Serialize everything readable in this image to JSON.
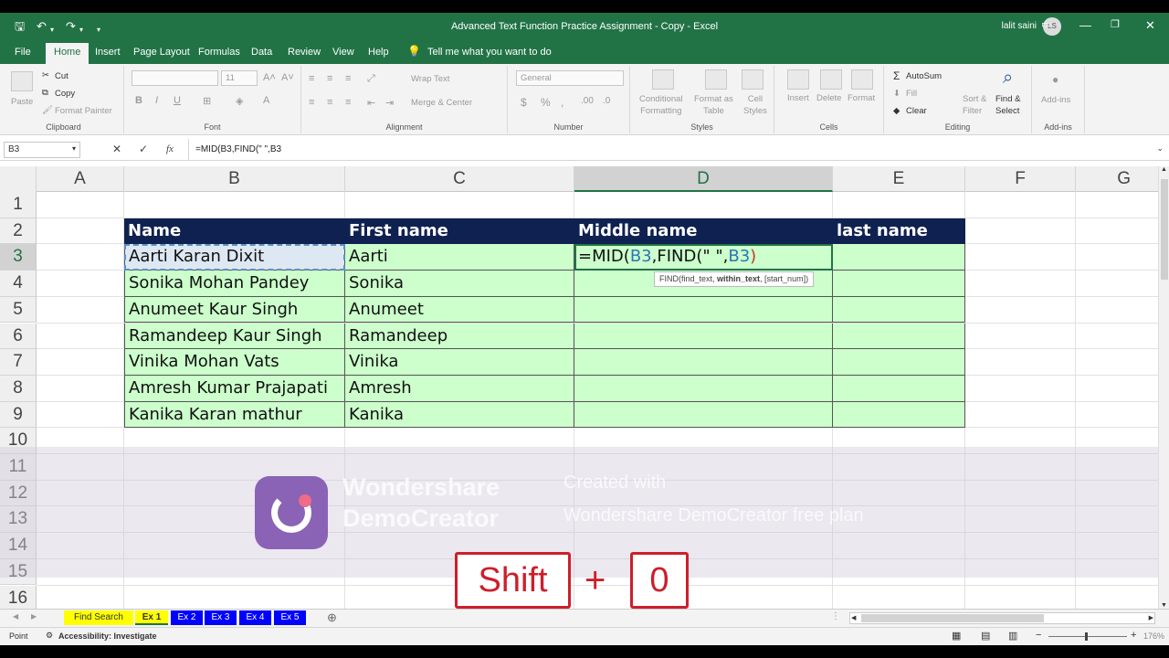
{
  "window": {
    "title": "Advanced Text Function Practice Assignment - Copy  -  Excel",
    "user": "lalit saini",
    "user_initials": "LS"
  },
  "qat": {
    "save": "🖫",
    "undo": "↶",
    "redo": "↷"
  },
  "tabs": [
    "File",
    "Home",
    "Insert",
    "Page Layout",
    "Formulas",
    "Data",
    "Review",
    "View",
    "Help"
  ],
  "tell_me": "Tell me what you want to do",
  "ribbon": {
    "clipboard": {
      "paste": "Paste",
      "cut": "Cut",
      "copy": "Copy",
      "format_painter": "Format Painter",
      "label": "Clipboard"
    },
    "font": {
      "size": "11",
      "label": "Font"
    },
    "alignment": {
      "wrap": "Wrap Text",
      "merge": "Merge & Center",
      "label": "Alignment"
    },
    "number": {
      "format": "General",
      "label": "Number"
    },
    "styles": {
      "cond": "Conditional\nFormatting",
      "fmt_table": "Format as\nTable",
      "cell_styles": "Cell\nStyles",
      "label": "Styles"
    },
    "cells": {
      "insert": "Insert",
      "delete": "Delete",
      "format": "Format",
      "label": "Cells"
    },
    "editing": {
      "autosum": "AutoSum",
      "fill": "Fill",
      "clear": "Clear",
      "sort": "Sort &\nFilter",
      "find": "Find &\nSelect",
      "label": "Editing"
    },
    "addins": {
      "addins": "Add-ins",
      "label": "Add-ins"
    }
  },
  "formula_bar": {
    "name_box": "B3",
    "formula": "=MID(B3,FIND(\" \",B3",
    "fx": "fx",
    "cancel": "✕",
    "enter": "✓"
  },
  "columns": [
    "A",
    "B",
    "C",
    "D",
    "E",
    "F",
    "G"
  ],
  "rows": [
    "1",
    "2",
    "3",
    "4",
    "5",
    "6",
    "7",
    "8",
    "9",
    "10",
    "11",
    "12",
    "13",
    "14",
    "15",
    "16"
  ],
  "table": {
    "headers": [
      "Name",
      "First name",
      "Middle name",
      "last name"
    ],
    "rows": [
      [
        "Aarti Karan Dixit",
        "Aarti"
      ],
      [
        "Sonika Mohan Pandey",
        "Sonika"
      ],
      [
        "Anumeet Kaur Singh",
        "Anumeet"
      ],
      [
        "Ramandeep Kaur Singh",
        "Ramandeep"
      ],
      [
        "Vinika Mohan Vats",
        "Vinika"
      ],
      [
        "Amresh Kumar Prajapati",
        "Amresh"
      ],
      [
        "Kanika Karan mathur",
        "Kanika"
      ]
    ]
  },
  "editing_cell": {
    "prefix": "=MID(",
    "ref1": "B3",
    "mid": ",FIND(\" \",",
    "ref2": "B3",
    "close": ")"
  },
  "tooltip": {
    "fn": "FIND(find_text, ",
    "bold": "within_text",
    "rest": ", [start_num])"
  },
  "watermark": {
    "line1": "Wondershare",
    "line2": "DemoCreator",
    "sub1": "Created with",
    "sub2": "Wondershare DemoCreator free plan"
  },
  "keys": {
    "key1": "Shift",
    "plus": "+",
    "key2": "0"
  },
  "sheets": [
    {
      "name": "Find Search",
      "bg": "#ffff00",
      "fg": "#333333"
    },
    {
      "name": "Ex 1",
      "bg": "#ffff00",
      "fg": "#333333"
    },
    {
      "name": "Ex 2",
      "bg": "#0000ff",
      "fg": "#ffffff"
    },
    {
      "name": "Ex 3",
      "bg": "#0000ff",
      "fg": "#ffffff"
    },
    {
      "name": "Ex 4",
      "bg": "#0000ff",
      "fg": "#ffffff"
    },
    {
      "name": "Ex 5",
      "bg": "#0000ff",
      "fg": "#ffffff"
    }
  ],
  "status": {
    "mode": "Point",
    "accessibility": "Accessibility: Investigate",
    "zoom": "176%"
  },
  "colors": {
    "excel_green": "#217346",
    "header_fill": "#0f2150",
    "data_fill": "#ccffcc",
    "key_red": "#cc1f2b"
  }
}
